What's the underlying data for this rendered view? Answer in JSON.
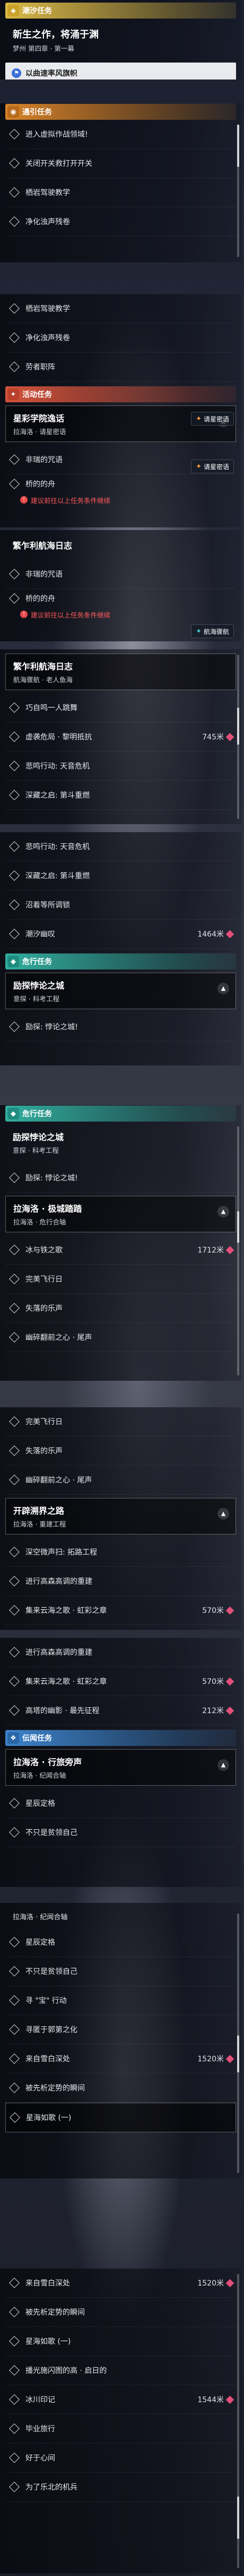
{
  "s1": {
    "section": "潮汐任务",
    "card_title": "新生之作，将涌于渊",
    "card_sub": "梦州 第四章 · 第一幕",
    "button": "以曲速率风旗帜"
  },
  "s2": {
    "section": "通引任务",
    "items": [
      "进入虚拟作战领域!",
      "关闭开关救打开开关",
      "栖岩驾驶教学",
      "净化浊声残卷"
    ]
  },
  "s3": {
    "items": [
      "栖岩驾驶教学",
      "净化浊声残卷",
      "劳者职阵"
    ],
    "section": "活动任务",
    "card_title": "星彩学院逸话",
    "card_sub": "拉海洛 · 请星密语",
    "rows": [
      "非瑞的咒语",
      "桥的的舟"
    ],
    "warning": "建议前往以上任务条件继续",
    "chip1": "请星密语",
    "chip2": "请星密语"
  },
  "s4": {
    "card_title": "繁乍利航海日志",
    "rows": [
      "非瑞的咒语",
      "桥的的舟"
    ],
    "warning": "建议前往以上任务条件继续",
    "chip": "航海骤航"
  },
  "s5": {
    "card_title": "繁乍利航海日志",
    "card_sub": "航海骤航 · 老人鱼海",
    "rows": [
      {
        "t": "巧自鸣一人跳舞",
        "d": ""
      },
      {
        "t": "虚袭危局 · 黎明抵抗",
        "d": "745米"
      },
      {
        "t": "悲鸣行动: 天音危机",
        "d": ""
      },
      {
        "t": "深藏之启: 第斗重燃",
        "d": ""
      }
    ]
  },
  "s6": {
    "rows": [
      {
        "t": "悲鸣行动: 天音危机",
        "d": ""
      },
      {
        "t": "深藏之启: 第斗重燃",
        "d": ""
      },
      {
        "t": "沼着等所调锁",
        "d": ""
      },
      {
        "t": "潮汐幽叹",
        "d": "1464米"
      }
    ],
    "section": "危行任务",
    "card_title": "励探悖论之城",
    "card_sub": "意探 · 科考工程",
    "sub_row": "励探: 悖论之城!"
  },
  "s7": {
    "section": "危行任务",
    "card_title": "励探悖论之城",
    "card_sub": "意探 · 科考工程",
    "sub_row": "励探: 悖论之城!",
    "card2_title": "拉海洛 · 极城踏踏",
    "card2_sub": "拉海洛 · 危行合轴",
    "rows": [
      {
        "t": "冰与铁之歌",
        "d": "1712米"
      },
      {
        "t": "完美飞行日",
        "d": ""
      },
      {
        "t": "失落的乐声",
        "d": ""
      },
      {
        "t": "幽碎翻前之心 · 尾声",
        "d": ""
      }
    ]
  },
  "s8": {
    "rows": [
      {
        "t": "完美飞行日",
        "d": ""
      },
      {
        "t": "失落的乐声",
        "d": ""
      },
      {
        "t": "幽碎翻前之心 · 尾声",
        "d": ""
      }
    ],
    "card_title": "开辟溯界之路",
    "card_sub": "拉海洛 · 重建工程",
    "rows2": [
      {
        "t": "深空微声扫: 拓路工程",
        "d": ""
      },
      {
        "t": "进行高森高调的重建",
        "d": ""
      },
      {
        "t": "集来云海之歌 · 虹彩之章",
        "d": "570米"
      }
    ]
  },
  "s9": {
    "rows": [
      {
        "t": "进行高森高调的重建",
        "d": ""
      },
      {
        "t": "集来云海之歌 · 虹彩之章",
        "d": "570米"
      },
      {
        "t": "高塔的幽影 · 最先征程",
        "d": "212米"
      }
    ],
    "section": "伝闻任务",
    "card_title": "拉海洛 · 行旅旁声",
    "card_sub": "拉海洛 · 纪闻合轴",
    "sub_rows": [
      "星辰定格",
      "不只是贫领自己"
    ]
  },
  "s10": {
    "title": "拉海洛 · 纪闻合轴",
    "rows": [
      {
        "t": "星辰定格",
        "d": ""
      },
      {
        "t": "不只是贫领自己",
        "d": ""
      },
      {
        "t": "寻 \"宝\" 行动",
        "d": ""
      },
      {
        "t": "寻匿于郭第之化",
        "d": ""
      },
      {
        "t": "来自雪白深处",
        "d": "1520米"
      },
      {
        "t": "被先析定势的瞬间",
        "d": ""
      },
      {
        "t": "星海如歌 (一)",
        "d": ""
      }
    ]
  },
  "s11": {
    "rows": [
      {
        "t": "来自雪白深处",
        "d": "1520米"
      },
      {
        "t": "被先析定势的瞬间",
        "d": ""
      },
      {
        "t": "星海如歌 (一)",
        "d": ""
      },
      {
        "t": "播光施闪图的高 · 启日的",
        "d": ""
      },
      {
        "t": "冰川印记",
        "d": "1544米"
      },
      {
        "t": "毕业旅行",
        "d": ""
      },
      {
        "t": "好于心间",
        "d": ""
      },
      {
        "t": "为了乐北的机兵",
        "d": ""
      }
    ]
  }
}
